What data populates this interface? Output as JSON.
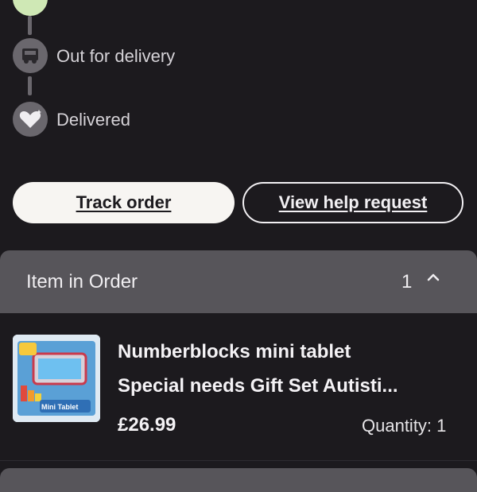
{
  "timeline": {
    "steps": [
      {
        "label": "Out for delivery",
        "icon": "truck-icon"
      },
      {
        "label": "Delivered",
        "icon": "heart-sparkle-icon"
      }
    ]
  },
  "actions": {
    "track_label": "Track order",
    "help_label": "View help request"
  },
  "items_section": {
    "title": "Item in Order",
    "count": "1"
  },
  "item": {
    "title_line1": "Numberblocks mini tablet",
    "title_line2": "Special needs Gift Set Autisti...",
    "price": "£26.99",
    "quantity": "Quantity: 1",
    "thumb_caption": "Mini Tablet"
  },
  "colors": {
    "background": "#1c1a1e",
    "section_header": "#57555a",
    "primary_button": "#f7f5f2",
    "step_icon": "#6a676d"
  }
}
